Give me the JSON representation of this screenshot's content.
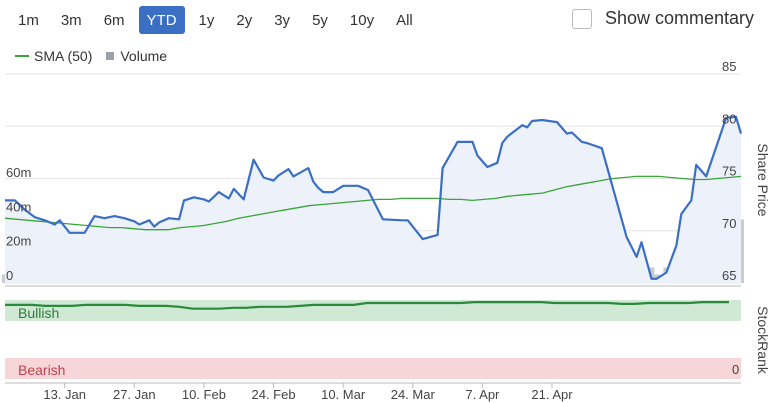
{
  "range_selector": {
    "options": [
      "1m",
      "3m",
      "6m",
      "YTD",
      "1y",
      "2y",
      "3y",
      "5y",
      "10y",
      "All"
    ],
    "selected": "YTD"
  },
  "commentary": {
    "label": "Show commentary",
    "checked": false
  },
  "legend": {
    "sma_label": "SMA (50)",
    "volume_label": "Volume"
  },
  "stockrank": {
    "axis_title": "StockRank",
    "bullish_label": "Bullish",
    "bearish_label": "Bearish",
    "tick_label": "0"
  },
  "colors": {
    "price": "#3a6fc4",
    "sma": "#3aa53a",
    "volume": "#c9ccd3",
    "bullish": "#cfe9d5",
    "bearish": "#f6d6d8",
    "selected": "#3a6fc4"
  },
  "chart_data": {
    "type": "line",
    "x_tick_labels": [
      "13. Jan",
      "27. Jan",
      "10. Feb",
      "24. Feb",
      "10. Mar",
      "24. Mar",
      "7. Apr",
      "21. Apr"
    ],
    "y_axis_title": "Share Price",
    "y_tick_labels": [
      "85",
      "80",
      "75",
      "70",
      "65"
    ],
    "ylim": [
      65,
      85
    ],
    "volume_tick_labels": [
      "60m",
      "40m",
      "20m",
      "0"
    ],
    "volume_ylim": [
      0,
      60
    ],
    "x_days": [
      0,
      2,
      4,
      6,
      8,
      10,
      11,
      13,
      15,
      16,
      18,
      20,
      22,
      24,
      26,
      27,
      29,
      30,
      31,
      33,
      35,
      36,
      38,
      40,
      41,
      43,
      45,
      46,
      48,
      50,
      52,
      54,
      55,
      57,
      58,
      61,
      62,
      63,
      64,
      66,
      68,
      71,
      73,
      76,
      80,
      81,
      84,
      87,
      88,
      91,
      94,
      95,
      97,
      99,
      100,
      101,
      104,
      105,
      106,
      108,
      111,
      113,
      114,
      116,
      117,
      120
    ],
    "series": [
      {
        "name": "Price",
        "values": [
          72.9,
          72.9,
          72.0,
          71.3,
          71.0,
          70.6,
          71.0,
          69.8,
          69.8,
          69.8,
          71.4,
          71.2,
          71.4,
          71.2,
          70.9,
          70.6,
          71.0,
          70.4,
          70.8,
          71.2,
          71.1,
          72.9,
          73.2,
          73.0,
          72.8,
          73.7,
          73.1,
          74.0,
          73.0,
          76.8,
          75.1,
          74.8,
          75.3,
          75.9,
          75.2,
          76.0,
          74.7,
          74.1,
          73.7,
          73.7,
          74.3,
          74.3,
          73.9,
          71.1,
          71.0,
          71.0,
          69.2,
          69.6,
          76.0,
          78.5,
          78.5,
          77.2,
          76.1,
          76.5,
          78.4,
          79.0,
          80.1,
          79.9,
          80.5,
          80.6,
          80.4,
          79.3,
          79.4,
          78.5,
          78.4,
          77.9
        ],
        "values_tail": [
          69.4,
          67.5,
          68.9,
          65.4,
          65.4,
          66.0,
          68.6,
          71.6,
          72.9,
          76.3,
          75.2,
          80.8,
          80.9,
          79.3
        ]
      },
      {
        "name": "SMA (50)",
        "values": [
          71.2,
          71.1,
          71.0,
          70.9,
          70.8,
          70.7,
          70.6,
          70.5,
          70.4,
          70.3,
          70.3,
          70.2,
          70.1,
          70.1,
          70.1,
          70.3,
          70.4,
          70.5,
          70.7,
          70.9,
          71.2,
          71.4,
          71.6,
          71.8,
          72.0,
          72.2,
          72.4,
          72.5,
          72.6,
          72.7,
          72.8,
          72.9,
          73.0,
          73.0,
          73.1,
          73.1,
          73.1,
          73.1,
          73.0,
          73.0,
          72.9,
          73.0,
          73.1,
          73.3,
          73.4,
          73.5,
          73.6,
          73.9,
          74.2,
          74.4,
          74.6,
          74.8,
          75.0,
          75.1,
          75.2,
          75.2,
          75.2,
          75.1,
          75.0,
          74.9,
          74.9,
          75.0,
          75.1,
          75.2
        ],
        "values_tail": []
      },
      {
        "name": "Volume",
        "values": [
          5,
          5,
          8,
          4,
          4,
          3,
          4,
          3,
          1,
          1,
          4,
          3,
          1,
          1,
          4,
          2,
          2,
          2,
          2,
          3,
          3,
          1,
          1,
          2,
          1,
          1,
          5,
          5,
          3,
          2,
          1,
          2,
          1,
          2,
          1,
          1,
          1,
          2,
          2,
          2,
          5,
          4,
          7,
          10,
          12,
          6,
          2,
          2,
          10,
          7,
          5,
          5,
          6,
          10,
          6,
          1,
          14,
          2,
          25,
          5,
          5,
          7,
          4,
          3,
          6,
          9,
          4
        ],
        "values_tail": [
          10,
          8,
          9,
          5,
          9,
          11,
          19,
          13,
          1,
          31,
          22,
          23,
          37,
          6
        ]
      }
    ],
    "tail_x_days": [
      125,
      127,
      128,
      130,
      131,
      133,
      135,
      136,
      138,
      139,
      141,
      145,
      147,
      148
    ],
    "stockrank": [
      78,
      78,
      78,
      77,
      77,
      77,
      78,
      78,
      78,
      78,
      77,
      77,
      77,
      76,
      74,
      74,
      74,
      75,
      75,
      76,
      76,
      76,
      77,
      78,
      78,
      78,
      78,
      80,
      80,
      80,
      80,
      80,
      80,
      80,
      80,
      81,
      81,
      81,
      81,
      81,
      81,
      80,
      80,
      80,
      80,
      80,
      79,
      79,
      80,
      80,
      80,
      80,
      81,
      81,
      81
    ]
  }
}
